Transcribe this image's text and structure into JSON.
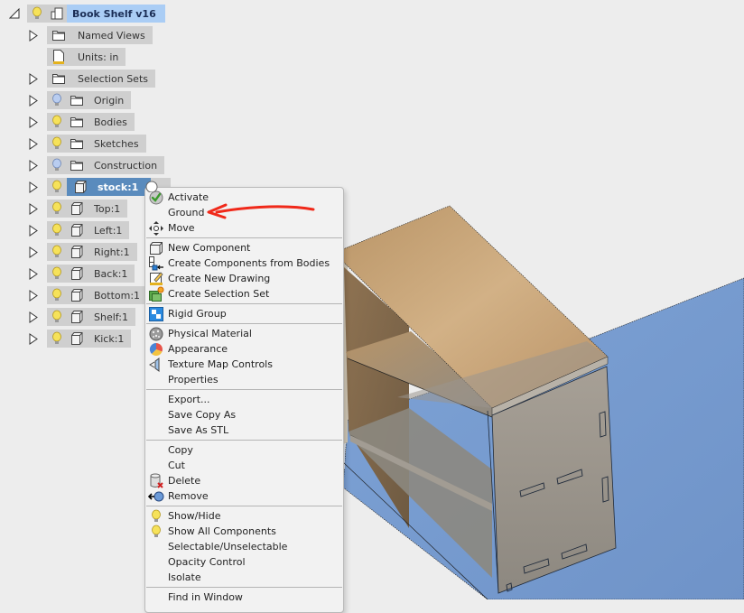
{
  "browser": {
    "root": {
      "label": "Book Shelf v16"
    },
    "items": [
      {
        "label": "Named Views",
        "type": "folder",
        "bulb": "none",
        "expandable": true
      },
      {
        "label": "Units: in",
        "type": "units",
        "bulb": "none",
        "expandable": false
      },
      {
        "label": "Selection Sets",
        "type": "folder",
        "bulb": "none",
        "expandable": true
      },
      {
        "label": "Origin",
        "type": "folder",
        "bulb": "blue",
        "expandable": true
      },
      {
        "label": "Bodies",
        "type": "folder",
        "bulb": "yellow",
        "expandable": true
      },
      {
        "label": "Sketches",
        "type": "folder",
        "bulb": "yellow",
        "expandable": true
      },
      {
        "label": "Construction",
        "type": "folder",
        "bulb": "blue",
        "expandable": true
      },
      {
        "label": "stock:1",
        "type": "component",
        "bulb": "yellow",
        "expandable": true,
        "selected": true
      },
      {
        "label": "Top:1",
        "type": "component",
        "bulb": "yellow",
        "expandable": true
      },
      {
        "label": "Left:1",
        "type": "component",
        "bulb": "yellow",
        "expandable": true
      },
      {
        "label": "Right:1",
        "type": "component",
        "bulb": "yellow",
        "expandable": true
      },
      {
        "label": "Back:1",
        "type": "component",
        "bulb": "yellow",
        "expandable": true
      },
      {
        "label": "Bottom:1",
        "type": "component",
        "bulb": "yellow",
        "expandable": true
      },
      {
        "label": "Shelf:1",
        "type": "component",
        "bulb": "yellow",
        "expandable": true
      },
      {
        "label": "Kick:1",
        "type": "component",
        "bulb": "yellow",
        "expandable": true
      }
    ]
  },
  "context_menu": {
    "groups": [
      [
        {
          "label": "Activate",
          "icon": "activate-check-icon"
        },
        {
          "label": "Ground",
          "icon": "none"
        },
        {
          "label": "Move",
          "icon": "move-arrows-icon"
        }
      ],
      [
        {
          "label": "New Component",
          "icon": "new-component-icon"
        },
        {
          "label": "Create Components from Bodies",
          "icon": "components-from-bodies-icon"
        },
        {
          "label": "Create New Drawing",
          "icon": "new-drawing-icon"
        },
        {
          "label": "Create Selection Set",
          "icon": "selection-set-icon"
        }
      ],
      [
        {
          "label": "Rigid Group",
          "icon": "rigid-group-icon"
        }
      ],
      [
        {
          "label": "Physical Material",
          "icon": "physical-material-icon"
        },
        {
          "label": "Appearance",
          "icon": "appearance-icon"
        },
        {
          "label": "Texture Map Controls",
          "icon": "texture-map-icon"
        },
        {
          "label": "Properties",
          "icon": "none"
        }
      ],
      [
        {
          "label": "Export...",
          "icon": "none"
        },
        {
          "label": "Save Copy As",
          "icon": "none"
        },
        {
          "label": "Save As STL",
          "icon": "none"
        }
      ],
      [
        {
          "label": "Copy",
          "icon": "none"
        },
        {
          "label": "Cut",
          "icon": "none"
        },
        {
          "label": "Delete",
          "icon": "delete-icon"
        },
        {
          "label": "Remove",
          "icon": "remove-icon"
        }
      ],
      [
        {
          "label": "Show/Hide",
          "icon": "lightbulb-icon"
        },
        {
          "label": "Show All Components",
          "icon": "lightbulb-icon"
        },
        {
          "label": "Selectable/Unselectable",
          "icon": "none"
        },
        {
          "label": "Opacity Control",
          "icon": "none"
        },
        {
          "label": "Isolate",
          "icon": "none"
        }
      ],
      [
        {
          "label": "Find in Window",
          "icon": "none"
        }
      ]
    ]
  },
  "colors": {
    "background": "#ededed",
    "ground_plane": "#7ba0d4",
    "selection_blue": "#5a8bbd",
    "root_highlight": "#aacdf5",
    "annotation_red": "#f0291a",
    "wood_light": "#c9a57a",
    "wood_grey": "#9c9790"
  }
}
